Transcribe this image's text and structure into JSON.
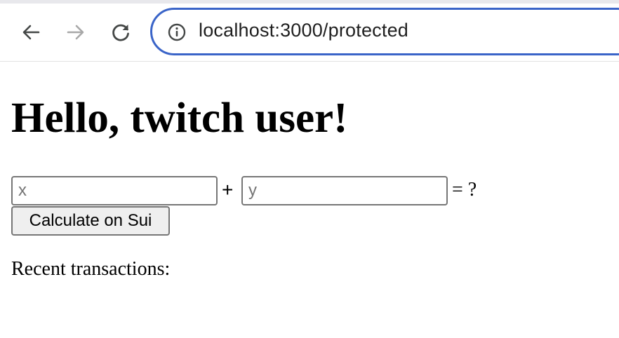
{
  "browser": {
    "url": "localhost:3000/protected",
    "icons": {
      "back": "arrow-left-icon",
      "forward": "arrow-right-icon",
      "reload": "reload-icon",
      "site_info": "info-icon"
    },
    "colors": {
      "address_border": "#3a64c8",
      "icon_active": "#444746",
      "icon_disabled": "#a8a8a8"
    }
  },
  "page": {
    "title": "Hello, twitch user!",
    "calculator": {
      "x_placeholder": "x",
      "y_placeholder": "y",
      "x_value": "",
      "y_value": "",
      "plus": "+",
      "equals": "= ?",
      "button_label": "Calculate on Sui"
    },
    "recent_label": "Recent transactions:"
  }
}
